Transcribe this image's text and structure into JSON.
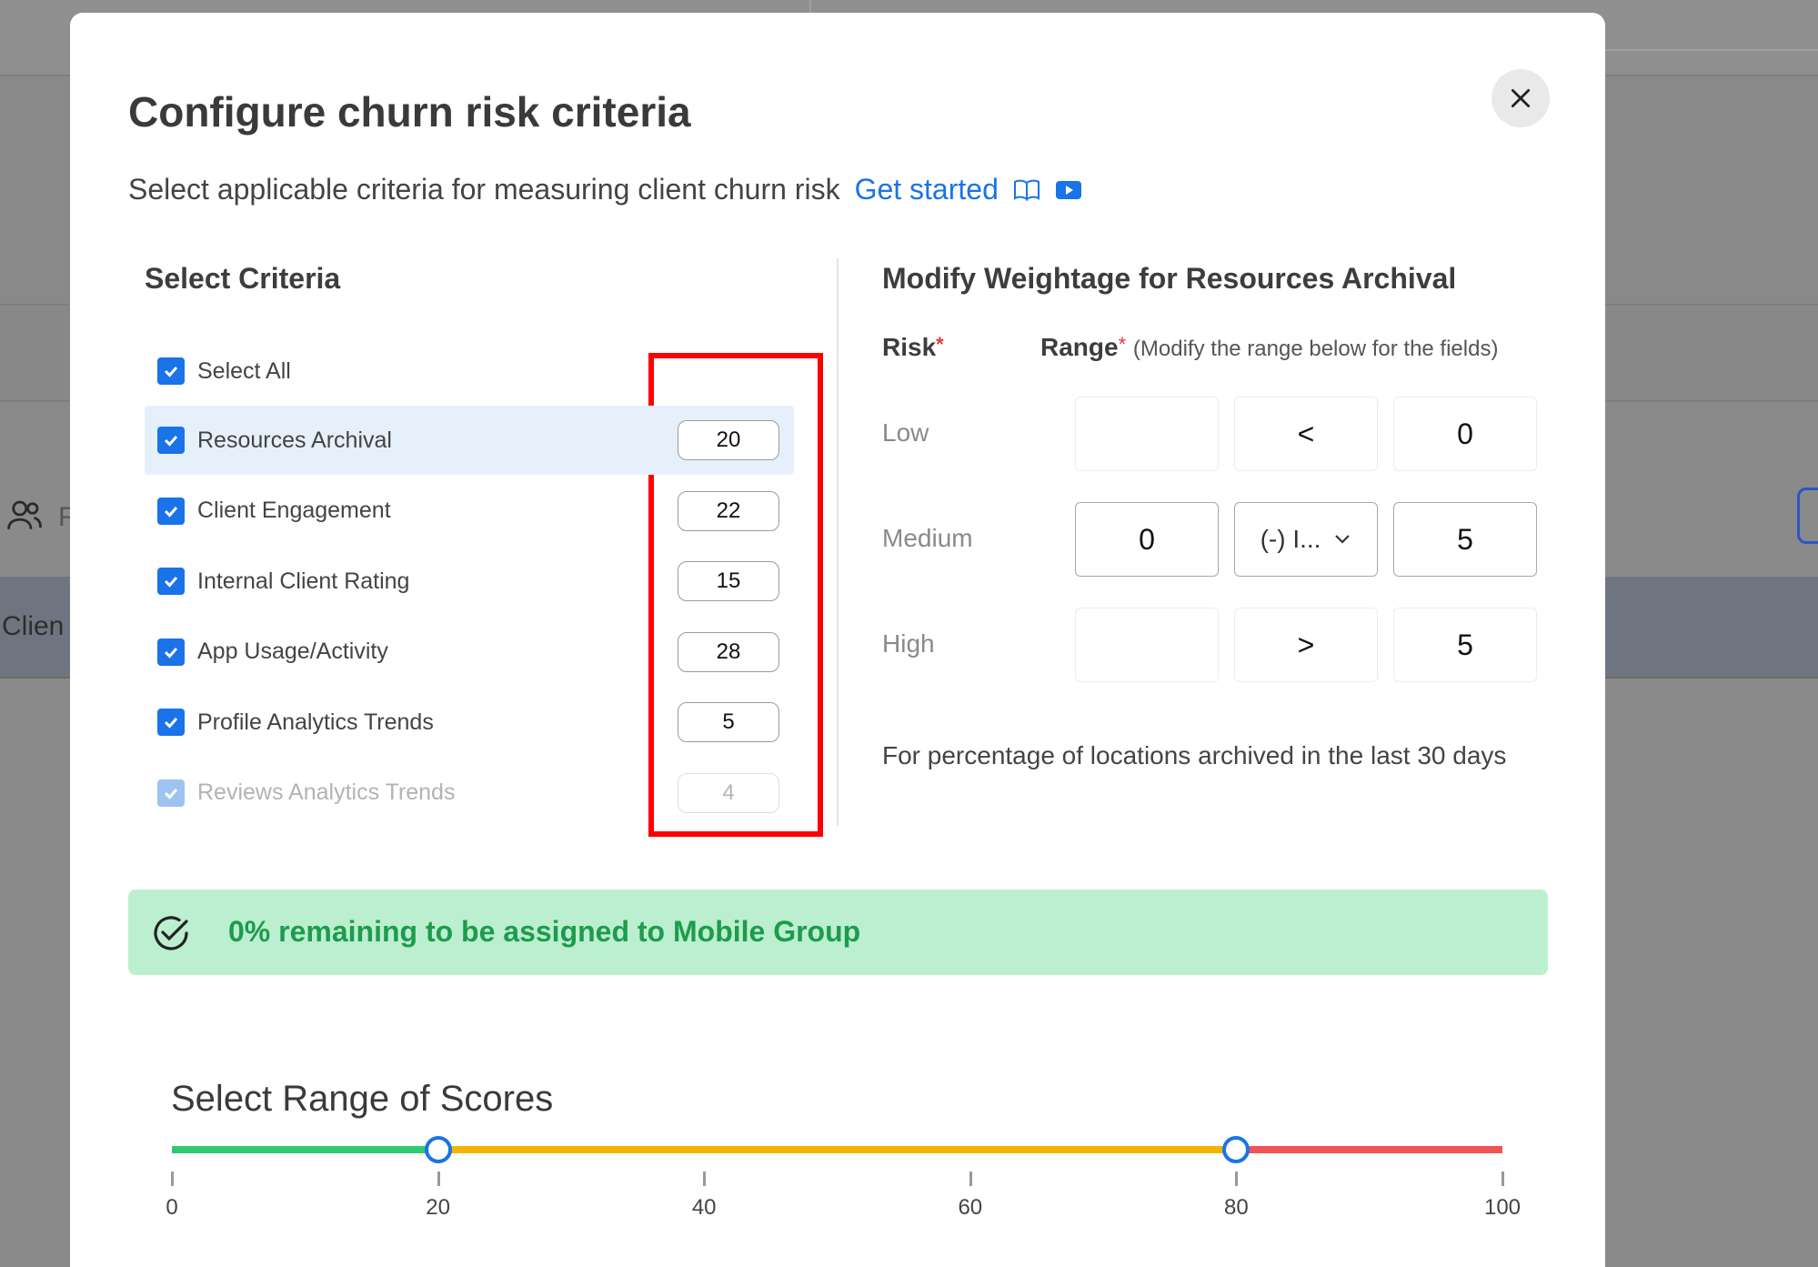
{
  "modal": {
    "title": "Configure churn risk criteria",
    "subtitle": "Select applicable criteria for measuring client churn risk",
    "get_started": "Get started"
  },
  "criteria": {
    "heading": "Select Criteria",
    "select_all": "Select All",
    "items": [
      {
        "label": "Resources Archival",
        "value": "20",
        "active": true,
        "disabled": false
      },
      {
        "label": "Client Engagement",
        "value": "22",
        "active": false,
        "disabled": false
      },
      {
        "label": "Internal Client Rating",
        "value": "15",
        "active": false,
        "disabled": false
      },
      {
        "label": "App Usage/Activity",
        "value": "28",
        "active": false,
        "disabled": false
      },
      {
        "label": "Profile Analytics Trends",
        "value": "5",
        "active": false,
        "disabled": false
      },
      {
        "label": "Reviews Analytics Trends",
        "value": "4",
        "active": false,
        "disabled": true
      }
    ]
  },
  "weightage": {
    "heading": "Modify Weightage for Resources Archival",
    "risk_label": "Risk",
    "range_label": "Range",
    "range_note": "(Modify the range below for the fields)",
    "required_mark": "*",
    "rows": [
      {
        "level": "Low",
        "from": "",
        "op": "<",
        "to": "0"
      },
      {
        "level": "Medium",
        "from": "0",
        "op": "(-) I...",
        "to": "5"
      },
      {
        "level": "High",
        "from": "",
        "op": ">",
        "to": "5"
      }
    ],
    "description": "For percentage of locations archived in the last 30 days"
  },
  "banner": {
    "text": "0% remaining to be assigned to Mobile Group",
    "color": "#1e9b4d"
  },
  "score_range": {
    "title": "Select Range of Scores",
    "min": 0,
    "max": 100,
    "low_handle": 20,
    "high_handle": 80,
    "ticks": [
      "0",
      "20",
      "40",
      "60",
      "80",
      "100"
    ],
    "colors": {
      "low": "#2ecc71",
      "medium": "#f5b400",
      "high": "#f05454"
    }
  },
  "background": {
    "partial_text": "Clien",
    "partial_letter": "F"
  }
}
